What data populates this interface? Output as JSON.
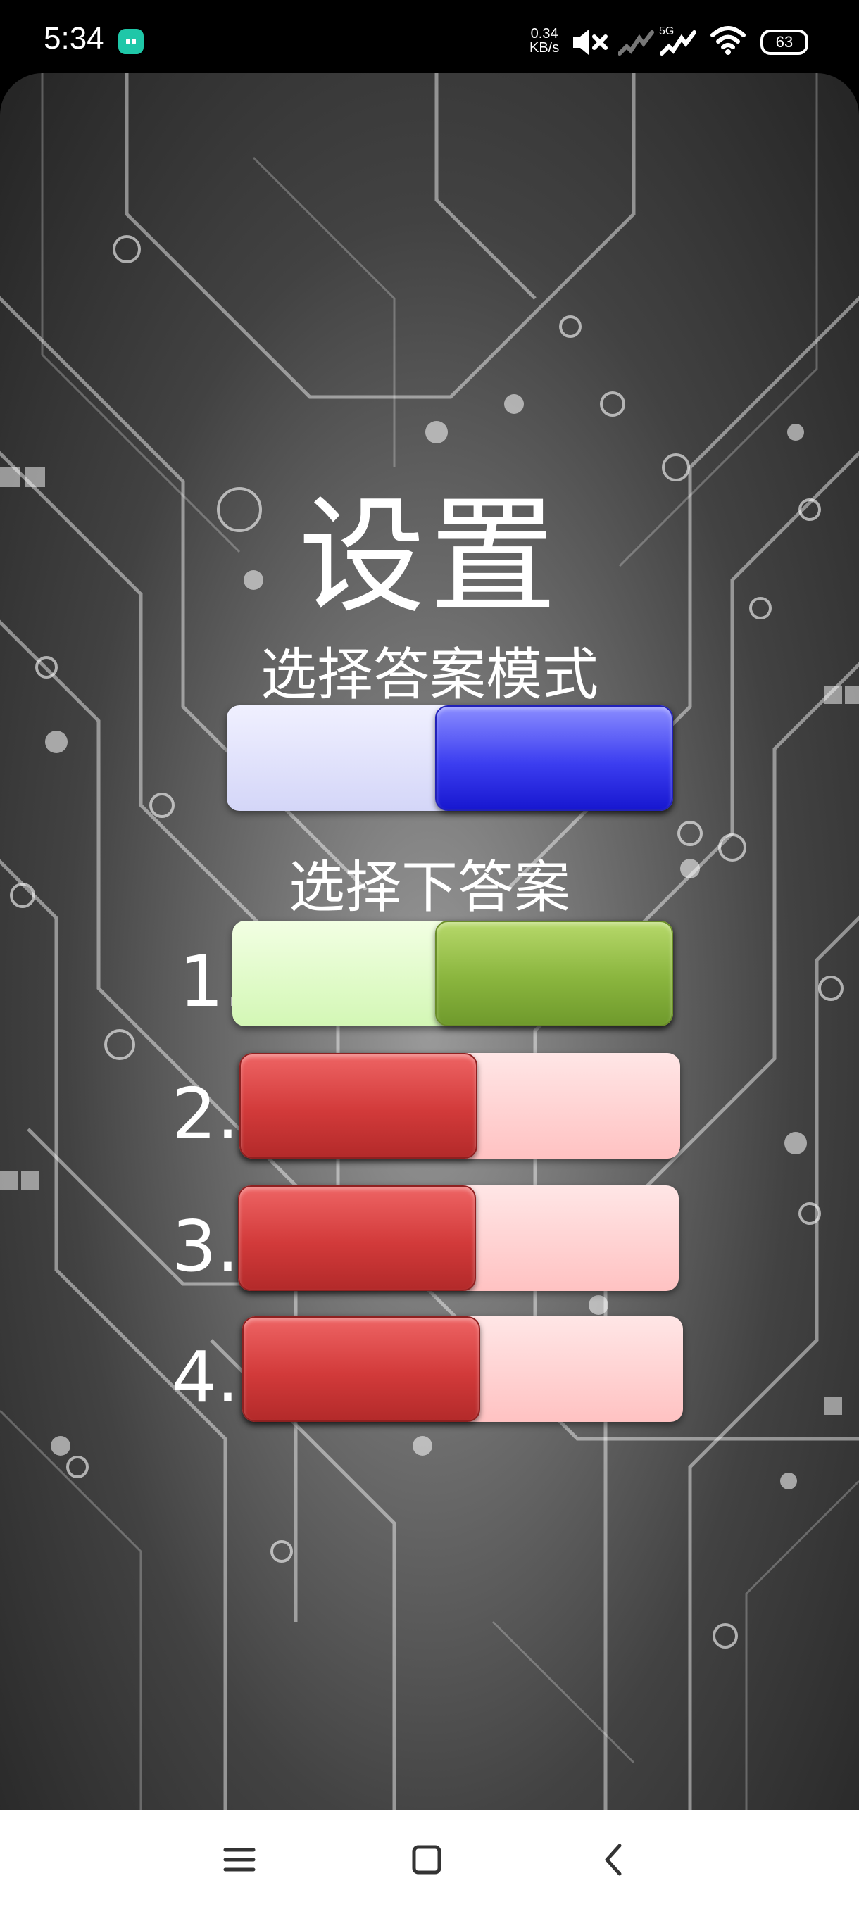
{
  "status_bar": {
    "time": "5:34",
    "speed_value": "0.34",
    "speed_unit": "KB/s",
    "network": "5G",
    "battery": "63",
    "icons": [
      "app-notification-icon",
      "mute-icon",
      "signal-icon",
      "signal-5g-icon",
      "wifi-icon",
      "battery-icon"
    ]
  },
  "page": {
    "title": "设置",
    "mode_label": "选择答案模式",
    "answer_label": "选择下答案"
  },
  "answers": [
    {
      "number": "1.",
      "state": "on",
      "color": "#8ab53e"
    },
    {
      "number": "2.",
      "state": "off",
      "color": "#d23a3a"
    },
    {
      "number": "3.",
      "state": "off",
      "color": "#d23a3a"
    },
    {
      "number": "4.",
      "state": "off",
      "color": "#d23a3a"
    }
  ],
  "mode_toggle": {
    "state": "on",
    "color": "#3c3ef0"
  },
  "nav_bar": {
    "icons": [
      "menu-icon",
      "home-icon",
      "back-icon"
    ]
  }
}
